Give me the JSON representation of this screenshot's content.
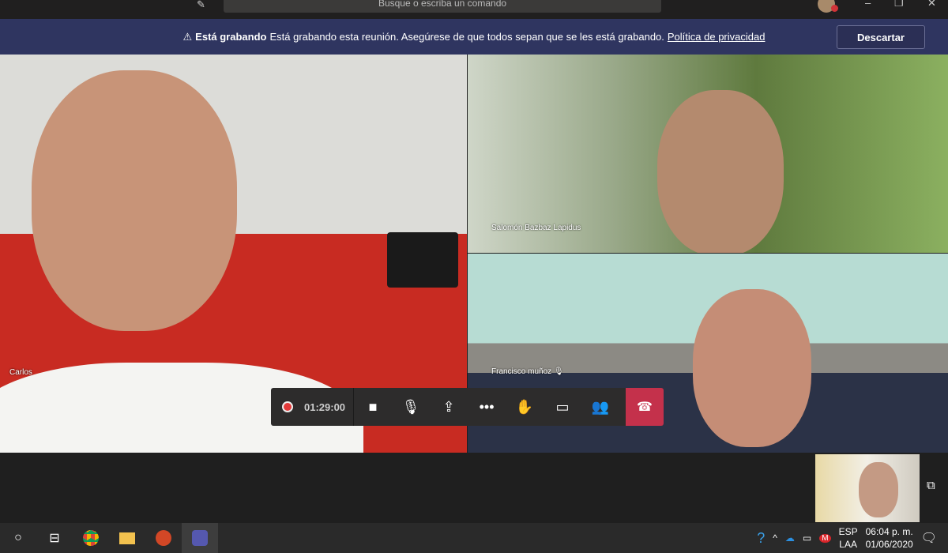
{
  "titlebar": {
    "search_placeholder": "Busque o escriba un comando",
    "minimize": "–",
    "maximize": "❐",
    "close": "✕"
  },
  "banner": {
    "title": "Está grabando",
    "message": "Está grabando esta reunión. Asegúrese de que todos sepan que se les está grabando.",
    "link": "Política de privacidad",
    "dismiss": "Descartar"
  },
  "participants": [
    {
      "name": "Carlos"
    },
    {
      "name": "Salomón Bazbaz Lapidus"
    },
    {
      "name": "Francisco muñoz"
    }
  ],
  "controls": {
    "recording_time": "01:29:00"
  },
  "colors": {
    "banner": "#2f3560",
    "hangup": "#c4314b",
    "record": "#e23a3a"
  },
  "tray": {
    "lang1": "ESP",
    "lang2": "LAA",
    "time": "06:04 p. m.",
    "date": "01/06/2020"
  }
}
